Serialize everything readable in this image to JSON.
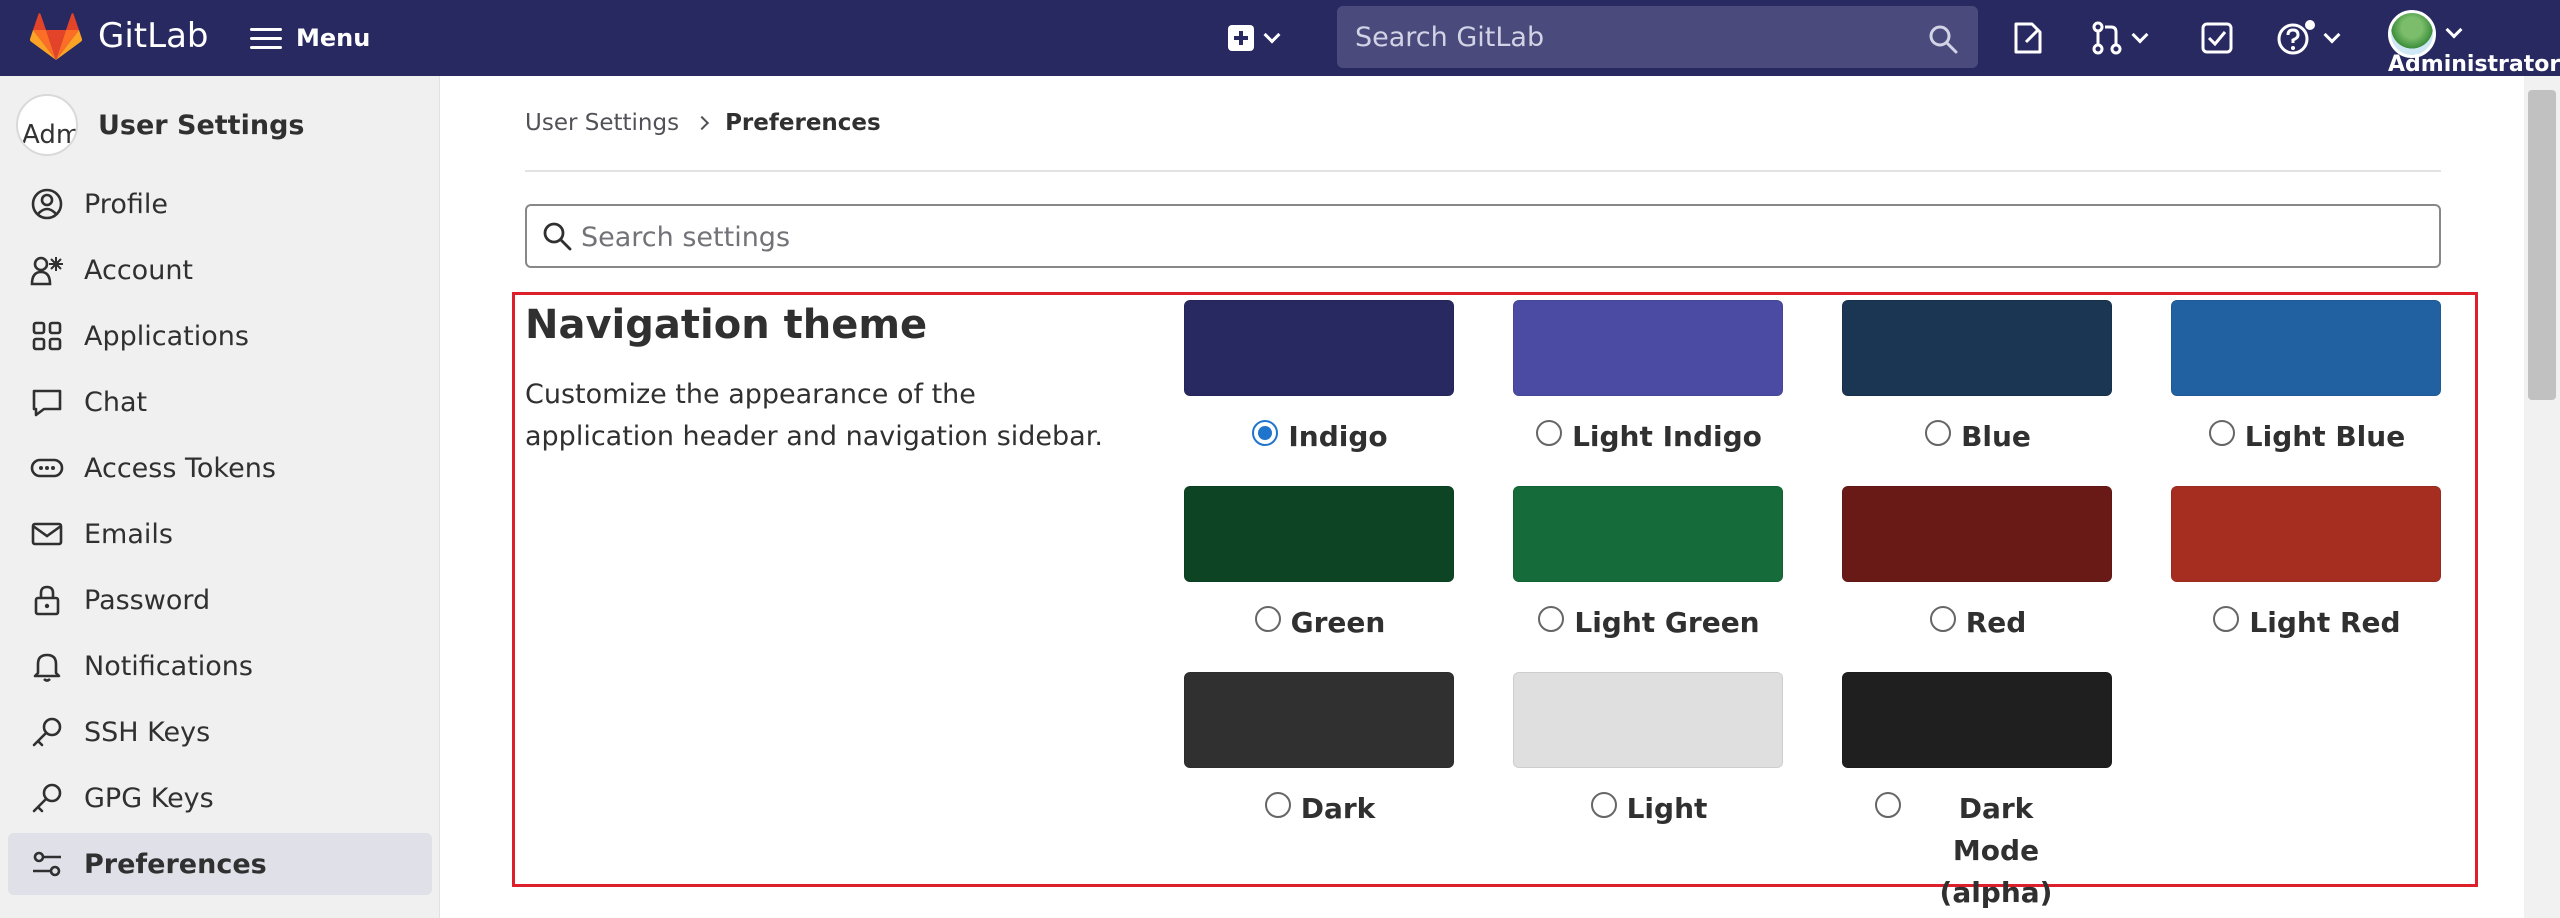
{
  "topbar": {
    "brand": "GitLab",
    "menu_label": "Menu",
    "search_placeholder": "Search GitLab",
    "user_label": "Administrator"
  },
  "sidebar": {
    "avatar_text": "Adm",
    "title": "User Settings",
    "items": [
      {
        "label": "Profile",
        "icon": "profile-icon"
      },
      {
        "label": "Account",
        "icon": "account-icon"
      },
      {
        "label": "Applications",
        "icon": "applications-icon"
      },
      {
        "label": "Chat",
        "icon": "chat-icon"
      },
      {
        "label": "Access Tokens",
        "icon": "token-icon"
      },
      {
        "label": "Emails",
        "icon": "mail-icon"
      },
      {
        "label": "Password",
        "icon": "lock-icon"
      },
      {
        "label": "Notifications",
        "icon": "bell-icon"
      },
      {
        "label": "SSH Keys",
        "icon": "key-icon"
      },
      {
        "label": "GPG Keys",
        "icon": "key-icon"
      },
      {
        "label": "Preferences",
        "icon": "preferences-icon",
        "active": true
      }
    ]
  },
  "breadcrumb": {
    "parent": "User Settings",
    "current": "Preferences"
  },
  "settings_search": {
    "placeholder": "Search settings"
  },
  "navigation_theme": {
    "title": "Navigation theme",
    "description": "Customize the appearance of the application header and navigation sidebar.",
    "selected": "Indigo",
    "themes": [
      {
        "name": "Indigo",
        "color": "#292961",
        "checked": true
      },
      {
        "name": "Light Indigo",
        "color": "#4b4ba3",
        "checked": false
      },
      {
        "name": "Blue",
        "color": "#1a3652",
        "checked": false
      },
      {
        "name": "Light Blue",
        "color": "#2261a1",
        "checked": false
      },
      {
        "name": "Green",
        "color": "#0d4524",
        "checked": false
      },
      {
        "name": "Light Green",
        "color": "#156b39",
        "checked": false
      },
      {
        "name": "Red",
        "color": "#691a16",
        "checked": false
      },
      {
        "name": "Light Red",
        "color": "#a62e21",
        "checked": false
      },
      {
        "name": "Dark",
        "color": "#303030",
        "checked": false
      },
      {
        "name": "Light",
        "color": "#dfdfdf",
        "checked": false
      },
      {
        "name": "Dark Mode (alpha)",
        "color": "#1f1f1f",
        "checked": false
      }
    ]
  }
}
